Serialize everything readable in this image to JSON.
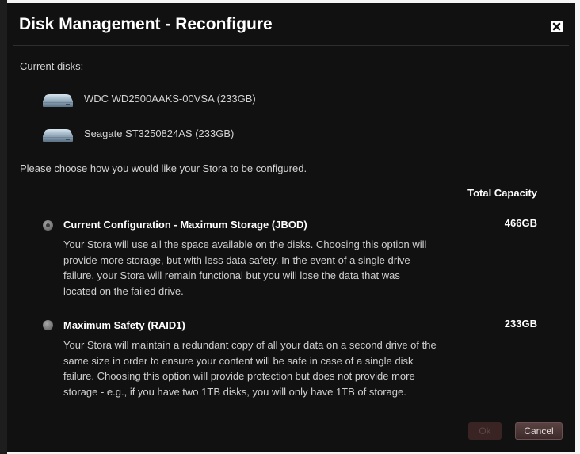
{
  "dialog": {
    "title": "Disk Management - Reconfigure",
    "close_icon": "close-icon"
  },
  "disks": {
    "label": "Current disks:",
    "items": [
      {
        "name": "WDC WD2500AAKS-00VSA  (233GB)",
        "icon": "hard-drive-icon"
      },
      {
        "name": "Seagate ST3250824AS  (233GB)",
        "icon": "hard-drive-icon"
      }
    ]
  },
  "prompt": "Please choose how you would like your Stora to be configured.",
  "capacity_header": "Total Capacity",
  "options": [
    {
      "title": "Current Configuration - Maximum Storage (JBOD)",
      "capacity": "466GB",
      "selected": true,
      "desc": [
        "Your Stora will use all the space available on the disks. Choosing this option will",
        "provide more storage, but with less data safety. In the event of a single drive",
        "failure, your Stora will remain functional but you will lose the data that was",
        "located on the failed drive."
      ]
    },
    {
      "title": "Maximum Safety (RAID1)",
      "capacity": "233GB",
      "selected": false,
      "desc": [
        "Your Stora will maintain a redundant copy of all your data on a second drive of the",
        "same size in order to ensure your content will be safe in case of a single disk",
        "failure. Choosing this option will provide protection but does not provide more",
        "storage - e.g., if you have two 1TB disks, you will only have 1TB of storage."
      ]
    }
  ],
  "buttons": {
    "ok": "Ok",
    "cancel": "Cancel"
  },
  "colors": {
    "dialog_bg": "#111111",
    "button_bg": "#4a3434"
  }
}
